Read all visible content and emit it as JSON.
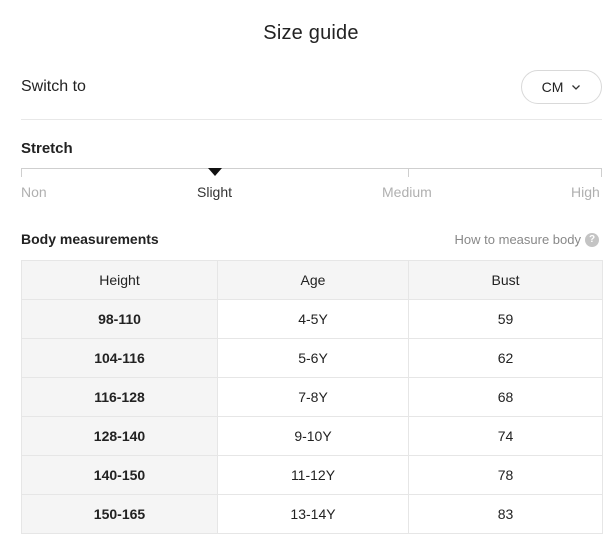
{
  "header": {
    "title": "Size guide"
  },
  "unit_switch": {
    "label": "Switch to",
    "value": "CM"
  },
  "stretch": {
    "title": "Stretch",
    "levels": [
      "Non",
      "Slight",
      "Medium",
      "High"
    ],
    "selected": "Slight"
  },
  "body_measurements": {
    "title": "Body measurements",
    "how_to_link": "How to measure body",
    "columns": [
      "Height",
      "Age",
      "Bust"
    ],
    "rows": [
      [
        "98-110",
        "4-5Y",
        "59"
      ],
      [
        "104-116",
        "5-6Y",
        "62"
      ],
      [
        "116-128",
        "7-8Y",
        "68"
      ],
      [
        "128-140",
        "9-10Y",
        "74"
      ],
      [
        "140-150",
        "11-12Y",
        "78"
      ],
      [
        "150-165",
        "13-14Y",
        "83"
      ]
    ]
  }
}
